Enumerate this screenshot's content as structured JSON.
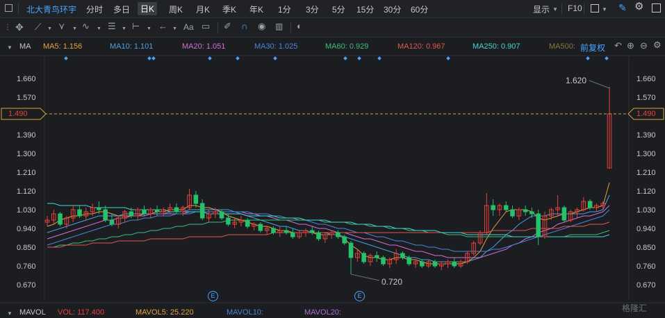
{
  "top_bar": {
    "stock_name": "北大青鸟环宇",
    "periods": [
      "分时",
      "多日",
      "日K",
      "周K",
      "月K",
      "季K",
      "年K",
      "1分",
      "3分",
      "5分",
      "15分",
      "30分",
      "60分"
    ],
    "active_period": "日K",
    "display_label": "显示",
    "f10_label": "F10"
  },
  "draw_tools": {
    "text_tool_label": "Aa"
  },
  "ma_bar": {
    "label": "MA",
    "items": [
      {
        "text": "MA5: 1.156",
        "color": "#e8a33d"
      },
      {
        "text": "MA10: 1.101",
        "color": "#4aa3df"
      },
      {
        "text": "MA20: 1.051",
        "color": "#d36fd8"
      },
      {
        "text": "MA30: 1.025",
        "color": "#4a86d9"
      },
      {
        "text": "MA60: 0.929",
        "color": "#3bbf7a"
      },
      {
        "text": "MA120: 0.967",
        "color": "#e0584f"
      },
      {
        "text": "MA250: 0.907",
        "color": "#45d6d6"
      },
      {
        "text": "MA500:",
        "color": "#8a7a3a"
      }
    ],
    "adjust_label": "前复权"
  },
  "axis": {
    "ticks": [
      "1.660",
      "1.570",
      "1.480",
      "1.390",
      "1.300",
      "1.210",
      "1.120",
      "1.030",
      "0.940",
      "0.850",
      "0.760",
      "0.670"
    ],
    "current_price": "1.490"
  },
  "annotations": {
    "high": "1.620",
    "low": "0.720",
    "event_marker": "E"
  },
  "volume_bar": {
    "label": "MAVOL",
    "vol": "VOL: 117.400",
    "mavol5": "MAVOL5: 25.220",
    "mavol10": "MAVOL10:",
    "mavol20": "MAVOL20:"
  },
  "watermark": "格隆汇",
  "colors": {
    "up": "#e8413b",
    "down": "#27c06b",
    "bg": "#1b1d21",
    "grid": "#2a2d33",
    "price_line": "#d9a23a"
  },
  "chart_data": {
    "type": "candlestick",
    "ylim": [
      0.63,
      1.7
    ],
    "current_price": 1.49,
    "high_label": 1.62,
    "low_label": 0.72,
    "ohlc": [
      [
        0.97,
        1.0,
        0.95,
        0.98
      ],
      [
        0.98,
        1.03,
        0.96,
        1.01
      ],
      [
        1.01,
        1.02,
        0.95,
        0.96
      ],
      [
        0.96,
        1.0,
        0.94,
        0.99
      ],
      [
        0.99,
        1.05,
        0.97,
        1.03
      ],
      [
        1.03,
        1.05,
        0.99,
        1.0
      ],
      [
        1.0,
        1.04,
        0.98,
        1.02
      ],
      [
        1.02,
        1.06,
        1.0,
        1.04
      ],
      [
        1.04,
        1.07,
        1.01,
        1.03
      ],
      [
        1.03,
        1.05,
        0.97,
        0.98
      ],
      [
        0.98,
        1.01,
        0.95,
        0.96
      ],
      [
        0.96,
        1.0,
        0.94,
        0.99
      ],
      [
        0.99,
        1.03,
        0.97,
        1.02
      ],
      [
        1.02,
        1.04,
        0.99,
        1.0
      ],
      [
        1.0,
        1.04,
        0.98,
        1.03
      ],
      [
        1.03,
        1.05,
        1.0,
        1.01
      ],
      [
        1.01,
        1.04,
        0.99,
        1.03
      ],
      [
        1.03,
        1.05,
        1.0,
        1.02
      ],
      [
        1.02,
        1.04,
        1.0,
        1.03
      ],
      [
        1.03,
        1.06,
        1.01,
        1.04
      ],
      [
        1.04,
        1.06,
        1.01,
        1.02
      ],
      [
        1.02,
        1.05,
        1.0,
        1.04
      ],
      [
        1.04,
        1.13,
        1.03,
        1.1
      ],
      [
        1.1,
        1.12,
        1.04,
        1.06
      ],
      [
        1.06,
        1.08,
        0.98,
        0.99
      ],
      [
        0.99,
        1.03,
        0.97,
        1.01
      ],
      [
        1.01,
        1.04,
        0.99,
        1.02
      ],
      [
        1.02,
        1.03,
        0.98,
        0.99
      ],
      [
        0.99,
        1.01,
        0.95,
        0.96
      ],
      [
        0.96,
        0.99,
        0.94,
        0.97
      ],
      [
        0.97,
        1.0,
        0.95,
        0.98
      ],
      [
        0.98,
        0.99,
        0.94,
        0.95
      ],
      [
        0.95,
        0.97,
        0.93,
        0.96
      ],
      [
        0.96,
        0.97,
        0.92,
        0.93
      ],
      [
        0.93,
        0.95,
        0.91,
        0.94
      ],
      [
        0.94,
        0.95,
        0.91,
        0.92
      ],
      [
        0.92,
        0.95,
        0.9,
        0.93
      ],
      [
        0.93,
        0.95,
        0.91,
        0.92
      ],
      [
        0.92,
        0.94,
        0.89,
        0.9
      ],
      [
        0.9,
        0.93,
        0.89,
        0.92
      ],
      [
        0.92,
        0.94,
        0.9,
        0.93
      ],
      [
        0.93,
        0.95,
        0.91,
        0.92
      ],
      [
        0.92,
        0.93,
        0.88,
        0.89
      ],
      [
        0.89,
        0.92,
        0.87,
        0.91
      ],
      [
        0.91,
        0.93,
        0.89,
        0.92
      ],
      [
        0.92,
        0.93,
        0.89,
        0.9
      ],
      [
        0.9,
        0.91,
        0.86,
        0.87
      ],
      [
        0.87,
        0.88,
        0.72,
        0.8
      ],
      [
        0.8,
        0.84,
        0.78,
        0.82
      ],
      [
        0.82,
        0.83,
        0.77,
        0.78
      ],
      [
        0.78,
        0.82,
        0.76,
        0.81
      ],
      [
        0.81,
        0.83,
        0.78,
        0.8
      ],
      [
        0.8,
        0.81,
        0.76,
        0.77
      ],
      [
        0.77,
        0.8,
        0.75,
        0.79
      ],
      [
        0.79,
        0.84,
        0.77,
        0.82
      ],
      [
        0.82,
        0.83,
        0.79,
        0.8
      ],
      [
        0.8,
        0.81,
        0.76,
        0.77
      ],
      [
        0.77,
        0.79,
        0.75,
        0.78
      ],
      [
        0.78,
        0.79,
        0.75,
        0.76
      ],
      [
        0.76,
        0.79,
        0.75,
        0.78
      ],
      [
        0.78,
        0.79,
        0.75,
        0.76
      ],
      [
        0.76,
        0.78,
        0.74,
        0.77
      ],
      [
        0.77,
        0.79,
        0.75,
        0.78
      ],
      [
        0.78,
        0.8,
        0.75,
        0.76
      ],
      [
        0.76,
        0.79,
        0.75,
        0.78
      ],
      [
        0.78,
        0.83,
        0.77,
        0.82
      ],
      [
        0.82,
        0.88,
        0.81,
        0.87
      ],
      [
        0.87,
        0.93,
        0.86,
        0.92
      ],
      [
        0.92,
        1.11,
        0.91,
        1.05
      ],
      [
        1.05,
        1.08,
        1.0,
        1.03
      ],
      [
        1.03,
        1.06,
        1.0,
        1.05
      ],
      [
        1.05,
        1.07,
        1.02,
        1.03
      ],
      [
        1.03,
        1.05,
        0.99,
        1.0
      ],
      [
        1.0,
        1.04,
        0.98,
        1.03
      ],
      [
        1.03,
        1.05,
        1.0,
        1.02
      ],
      [
        1.02,
        1.04,
        0.99,
        1.01
      ],
      [
        1.01,
        1.03,
        0.86,
        0.9
      ],
      [
        0.9,
        1.02,
        0.89,
        1.0
      ],
      [
        1.0,
        1.04,
        0.98,
        1.03
      ],
      [
        1.03,
        1.1,
        1.0,
        1.04
      ],
      [
        1.04,
        1.05,
        0.97,
        0.98
      ],
      [
        0.98,
        1.03,
        0.97,
        1.02
      ],
      [
        1.02,
        1.04,
        0.99,
        1.03
      ],
      [
        1.03,
        1.09,
        1.02,
        1.07
      ],
      [
        1.07,
        1.08,
        1.03,
        1.04
      ],
      [
        1.04,
        1.06,
        1.02,
        1.05
      ],
      [
        1.05,
        1.07,
        1.03,
        1.06
      ],
      [
        1.23,
        1.62,
        1.23,
        1.49
      ]
    ],
    "ma_series": [
      {
        "name": "MA5",
        "color": "#e8a33d",
        "values": [
          0.95,
          0.96,
          0.98,
          0.99,
          1.0,
          1.0,
          1.01,
          1.01,
          1.02,
          1.02,
          1.01,
          1.0,
          1.0,
          1.0,
          1.0,
          1.01,
          1.01,
          1.02,
          1.02,
          1.03,
          1.03,
          1.03,
          1.05,
          1.05,
          1.04,
          1.04,
          1.03,
          1.02,
          1.0,
          0.99,
          0.98,
          0.97,
          0.96,
          0.95,
          0.95,
          0.94,
          0.93,
          0.93,
          0.92,
          0.92,
          0.92,
          0.92,
          0.91,
          0.91,
          0.91,
          0.91,
          0.89,
          0.86,
          0.84,
          0.81,
          0.8,
          0.8,
          0.79,
          0.79,
          0.8,
          0.8,
          0.79,
          0.79,
          0.78,
          0.77,
          0.77,
          0.77,
          0.77,
          0.77,
          0.77,
          0.78,
          0.8,
          0.83,
          0.89,
          0.94,
          0.98,
          1.02,
          1.03,
          1.03,
          1.03,
          1.02,
          0.99,
          0.98,
          0.99,
          1.0,
          1.01,
          1.01,
          1.02,
          1.03,
          1.04,
          1.04,
          1.05,
          1.16
        ]
      },
      {
        "name": "MA10",
        "color": "#4aa3df",
        "values": [
          0.92,
          0.93,
          0.94,
          0.95,
          0.96,
          0.97,
          0.98,
          0.99,
          1.0,
          1.0,
          1.0,
          1.0,
          1.01,
          1.01,
          1.01,
          1.01,
          1.01,
          1.01,
          1.01,
          1.02,
          1.02,
          1.02,
          1.03,
          1.03,
          1.03,
          1.03,
          1.03,
          1.03,
          1.03,
          1.02,
          1.01,
          1.0,
          0.99,
          0.98,
          0.97,
          0.96,
          0.95,
          0.95,
          0.94,
          0.93,
          0.93,
          0.92,
          0.92,
          0.92,
          0.91,
          0.91,
          0.9,
          0.89,
          0.88,
          0.87,
          0.86,
          0.85,
          0.84,
          0.83,
          0.82,
          0.81,
          0.8,
          0.8,
          0.79,
          0.79,
          0.78,
          0.78,
          0.78,
          0.78,
          0.78,
          0.78,
          0.79,
          0.8,
          0.83,
          0.85,
          0.88,
          0.91,
          0.93,
          0.96,
          0.98,
          1.0,
          1.0,
          1.0,
          1.01,
          1.01,
          1.01,
          1.01,
          1.01,
          1.01,
          1.02,
          1.02,
          1.03,
          1.1
        ]
      },
      {
        "name": "MA20",
        "color": "#d36fd8",
        "values": [
          0.89,
          0.9,
          0.91,
          0.92,
          0.93,
          0.94,
          0.95,
          0.96,
          0.97,
          0.98,
          0.98,
          0.99,
          0.99,
          1.0,
          1.0,
          1.0,
          1.01,
          1.01,
          1.01,
          1.01,
          1.01,
          1.01,
          1.02,
          1.02,
          1.02,
          1.02,
          1.02,
          1.02,
          1.02,
          1.02,
          1.02,
          1.01,
          1.01,
          1.0,
          1.0,
          0.99,
          0.98,
          0.98,
          0.97,
          0.96,
          0.96,
          0.95,
          0.94,
          0.94,
          0.93,
          0.92,
          0.92,
          0.91,
          0.9,
          0.89,
          0.89,
          0.88,
          0.87,
          0.86,
          0.86,
          0.85,
          0.84,
          0.83,
          0.83,
          0.82,
          0.81,
          0.81,
          0.8,
          0.8,
          0.8,
          0.8,
          0.8,
          0.8,
          0.81,
          0.82,
          0.83,
          0.84,
          0.86,
          0.87,
          0.89,
          0.9,
          0.92,
          0.93,
          0.94,
          0.96,
          0.97,
          0.98,
          0.99,
          1.0,
          1.0,
          1.01,
          1.02,
          1.05
        ]
      },
      {
        "name": "MA30",
        "color": "#4a86d9",
        "values": [
          0.86,
          0.87,
          0.88,
          0.89,
          0.9,
          0.91,
          0.92,
          0.93,
          0.94,
          0.95,
          0.96,
          0.96,
          0.97,
          0.98,
          0.98,
          0.99,
          0.99,
          1.0,
          1.0,
          1.0,
          1.01,
          1.01,
          1.01,
          1.02,
          1.02,
          1.02,
          1.02,
          1.02,
          1.02,
          1.02,
          1.02,
          1.02,
          1.01,
          1.01,
          1.01,
          1.0,
          1.0,
          0.99,
          0.99,
          0.98,
          0.98,
          0.97,
          0.96,
          0.96,
          0.95,
          0.94,
          0.94,
          0.93,
          0.92,
          0.92,
          0.91,
          0.9,
          0.9,
          0.89,
          0.88,
          0.88,
          0.87,
          0.86,
          0.86,
          0.85,
          0.85,
          0.84,
          0.84,
          0.83,
          0.83,
          0.83,
          0.83,
          0.83,
          0.83,
          0.84,
          0.84,
          0.85,
          0.86,
          0.87,
          0.88,
          0.89,
          0.9,
          0.91,
          0.92,
          0.93,
          0.94,
          0.95,
          0.96,
          0.97,
          0.98,
          0.99,
          1.0,
          1.03
        ]
      },
      {
        "name": "MA60",
        "color": "#3bbf7a",
        "values": [
          0.85,
          0.85,
          0.86,
          0.86,
          0.87,
          0.87,
          0.88,
          0.88,
          0.89,
          0.89,
          0.9,
          0.9,
          0.91,
          0.91,
          0.92,
          0.92,
          0.93,
          0.93,
          0.94,
          0.94,
          0.95,
          0.95,
          0.96,
          0.96,
          0.96,
          0.97,
          0.97,
          0.97,
          0.98,
          0.98,
          0.98,
          0.98,
          0.98,
          0.98,
          0.98,
          0.98,
          0.98,
          0.98,
          0.98,
          0.98,
          0.98,
          0.98,
          0.98,
          0.97,
          0.97,
          0.97,
          0.97,
          0.96,
          0.96,
          0.96,
          0.95,
          0.95,
          0.95,
          0.94,
          0.94,
          0.94,
          0.93,
          0.93,
          0.93,
          0.92,
          0.92,
          0.92,
          0.91,
          0.91,
          0.91,
          0.9,
          0.9,
          0.9,
          0.9,
          0.9,
          0.9,
          0.9,
          0.9,
          0.9,
          0.9,
          0.9,
          0.9,
          0.9,
          0.9,
          0.9,
          0.9,
          0.91,
          0.91,
          0.91,
          0.91,
          0.91,
          0.92,
          0.93
        ]
      },
      {
        "name": "MA120",
        "color": "#e0584f",
        "values": [
          0.85,
          0.85,
          0.85,
          0.86,
          0.86,
          0.86,
          0.86,
          0.87,
          0.87,
          0.87,
          0.87,
          0.88,
          0.88,
          0.88,
          0.88,
          0.88,
          0.89,
          0.89,
          0.89,
          0.89,
          0.89,
          0.89,
          0.9,
          0.9,
          0.9,
          0.9,
          0.9,
          0.9,
          0.91,
          0.91,
          0.91,
          0.91,
          0.91,
          0.91,
          0.91,
          0.92,
          0.92,
          0.92,
          0.92,
          0.92,
          0.92,
          0.92,
          0.92,
          0.92,
          0.92,
          0.92,
          0.92,
          0.92,
          0.92,
          0.92,
          0.92,
          0.92,
          0.92,
          0.92,
          0.92,
          0.92,
          0.92,
          0.92,
          0.92,
          0.92,
          0.92,
          0.92,
          0.92,
          0.92,
          0.92,
          0.92,
          0.92,
          0.92,
          0.92,
          0.93,
          0.93,
          0.93,
          0.93,
          0.93,
          0.93,
          0.94,
          0.94,
          0.94,
          0.94,
          0.94,
          0.95,
          0.95,
          0.95,
          0.95,
          0.96,
          0.96,
          0.96,
          0.97
        ]
      },
      {
        "name": "MA250",
        "color": "#45d6d6",
        "values": [
          1.06,
          1.06,
          1.05,
          1.05,
          1.05,
          1.05,
          1.05,
          1.04,
          1.04,
          1.04,
          1.04,
          1.04,
          1.04,
          1.03,
          1.03,
          1.03,
          1.03,
          1.03,
          1.03,
          1.02,
          1.02,
          1.02,
          1.02,
          1.02,
          1.02,
          1.01,
          1.01,
          1.01,
          1.01,
          1.01,
          1.01,
          1.0,
          1.0,
          1.0,
          1.0,
          1.0,
          0.99,
          0.99,
          0.99,
          0.99,
          0.98,
          0.98,
          0.98,
          0.98,
          0.97,
          0.97,
          0.97,
          0.97,
          0.96,
          0.96,
          0.96,
          0.95,
          0.95,
          0.95,
          0.94,
          0.94,
          0.94,
          0.93,
          0.93,
          0.93,
          0.93,
          0.92,
          0.92,
          0.92,
          0.92,
          0.91,
          0.91,
          0.91,
          0.91,
          0.91,
          0.91,
          0.91,
          0.9,
          0.9,
          0.9,
          0.9,
          0.9,
          0.9,
          0.9,
          0.9,
          0.9,
          0.9,
          0.9,
          0.9,
          0.9,
          0.9,
          0.9,
          0.91
        ]
      }
    ]
  }
}
